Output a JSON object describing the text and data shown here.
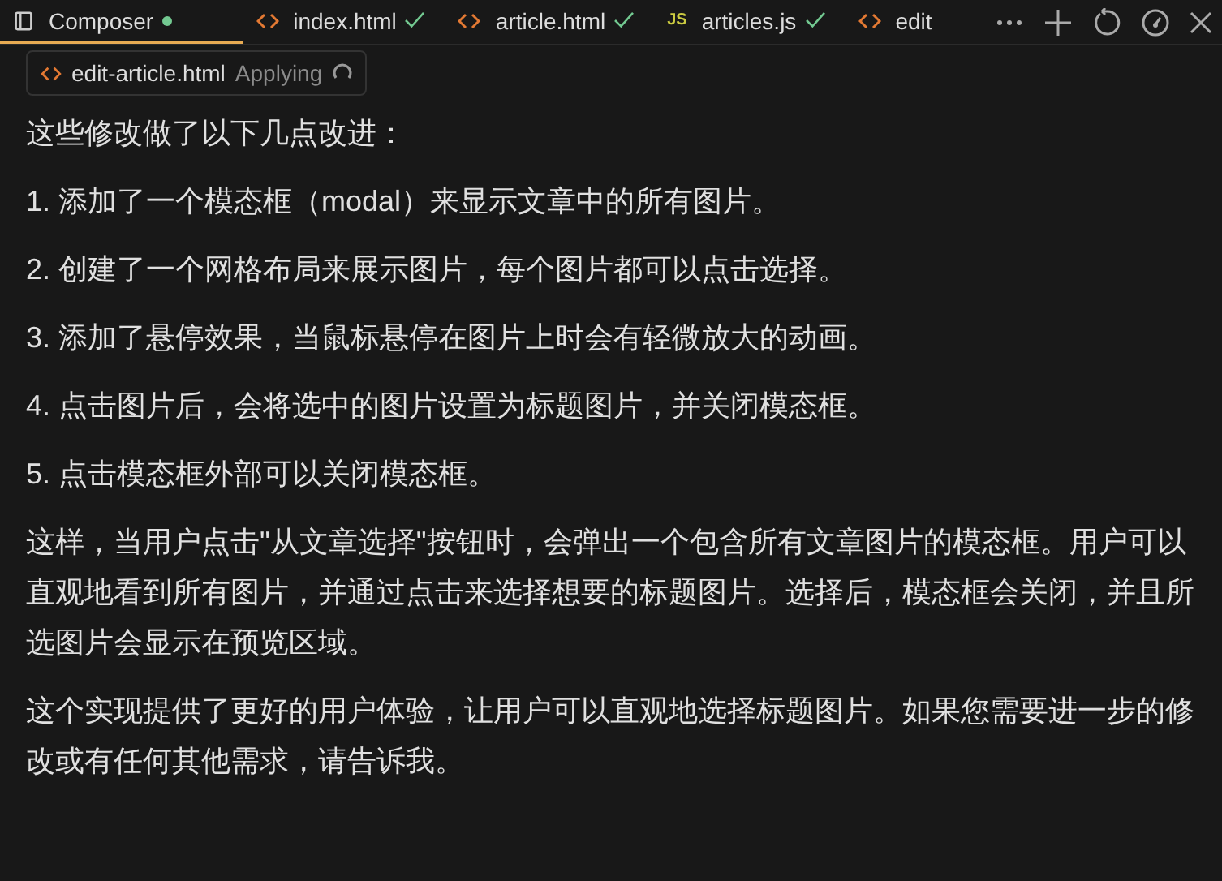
{
  "tabs": [
    {
      "label": "Composer",
      "kind": "composer",
      "selected": true,
      "modified": true,
      "accepted": false
    },
    {
      "label": "index.html",
      "kind": "html",
      "selected": false,
      "modified": false,
      "accepted": true
    },
    {
      "label": "article.html",
      "kind": "html",
      "selected": false,
      "modified": false,
      "accepted": true
    },
    {
      "label": "articles.js",
      "kind": "js",
      "icon_text": "JS",
      "selected": false,
      "modified": false,
      "accepted": true
    },
    {
      "label": "edit",
      "kind": "html",
      "selected": false,
      "modified": false,
      "accepted": false
    }
  ],
  "file_chip": {
    "name": "edit-article.html",
    "status": "Applying"
  },
  "paragraphs": [
    "这些修改做了以下几点改进：",
    "1. 添加了一个模态框（modal）来显示文章中的所有图片。",
    "2. 创建了一个网格布局来展示图片，每个图片都可以点击选择。",
    "3. 添加了悬停效果，当鼠标悬停在图片上时会有轻微放大的动画。",
    "4. 点击图片后，会将选中的图片设置为标题图片，并关闭模态框。",
    "5. 点击模态框外部可以关闭模态框。",
    "这样，当用户点击\"从文章选择\"按钮时，会弹出一个包含所有文章图片的模态框。用户可以直观地看到所有图片，并通过点击来选择想要的标题图片。选择后，模态框会关闭，并且所选图片会显示在预览区域。",
    "这个实现提供了更好的用户体验，让用户可以直观地选择标题图片。如果您需要进一步的修改或有任何其他需求，请告诉我。"
  ]
}
